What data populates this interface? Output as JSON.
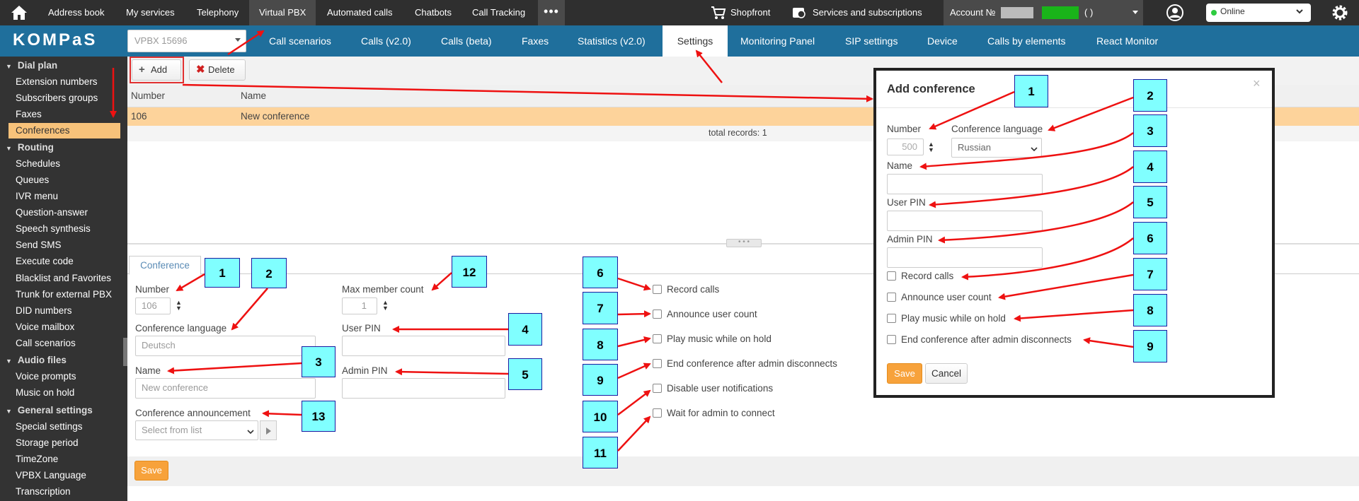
{
  "topbar": {
    "items": [
      "Address book",
      "My services",
      "Telephony",
      "Virtual PBX",
      "Automated calls",
      "Chatbots",
      "Call Tracking"
    ],
    "shopfront": "Shopfront",
    "services": "Services and subscriptions",
    "account": "Account №",
    "account_suffix": "( )",
    "status": "Online"
  },
  "logo": "KOMPaS",
  "vpbx_select": "VPBX 15696",
  "tabs": [
    "Call scenarios",
    "Calls (v2.0)",
    "Calls (beta)",
    "Faxes",
    "Statistics (v2.0)",
    "Settings",
    "Monitoring Panel",
    "SIP settings",
    "Device",
    "Calls by elements",
    "React Monitor"
  ],
  "sidebar": {
    "dial_plan": "Dial plan",
    "dial_items": [
      "Extension numbers",
      "Subscribers groups",
      "Faxes",
      "Conferences"
    ],
    "routing": "Routing",
    "routing_items": [
      "Schedules",
      "Queues",
      "IVR menu",
      "Question-answer",
      "Speech synthesis",
      "Send SMS",
      "Execute code",
      "Blacklist and Favorites",
      "Trunk for external PBX",
      "DID numbers",
      "Voice mailbox",
      "Call scenarios"
    ],
    "audio": "Audio files",
    "audio_items": [
      "Voice prompts",
      "Music on hold"
    ],
    "general": "General settings",
    "general_items": [
      "Special settings",
      "Storage period",
      "TimeZone",
      "VPBX Language",
      "Transcription"
    ]
  },
  "toolbar": {
    "add": "Add",
    "delete": "Delete"
  },
  "table": {
    "headers": [
      "Number",
      "Name"
    ],
    "rows": [
      [
        "106",
        "New conference"
      ]
    ],
    "total": "total records: 1"
  },
  "form": {
    "tab": "Conference",
    "number_label": "Number",
    "number_value": "106",
    "lang_label": "Conference language",
    "lang_value": "Deutsch",
    "name_label": "Name",
    "name_placeholder": "New conference",
    "announce_label": "Conference announcement",
    "announce_placeholder": "Select from list",
    "max_label": "Max member count",
    "max_value": "1",
    "user_pin_label": "User PIN",
    "admin_pin_label": "Admin PIN",
    "checkboxes": [
      "Record calls",
      "Announce user count",
      "Play music while on hold",
      "End conference after admin disconnects",
      "Disable user notifications",
      "Wait for admin to connect"
    ],
    "save": "Save"
  },
  "dialog": {
    "title": "Add conference",
    "close": "×",
    "number_label": "Number",
    "number_placeholder": "500",
    "lang_label": "Conference language",
    "lang_value": "Russian",
    "name_label": "Name",
    "user_pin_label": "User PIN",
    "admin_pin_label": "Admin PIN",
    "checkboxes": [
      "Record calls",
      "Announce user count",
      "Play music while on hold",
      "End conference after admin disconnects"
    ],
    "save": "Save",
    "cancel": "Cancel"
  },
  "annotations": {
    "form_numbers": [
      "1",
      "2",
      "3",
      "4",
      "5",
      "6",
      "7",
      "8",
      "9",
      "10",
      "11",
      "12",
      "13"
    ],
    "dialog_numbers": [
      "1",
      "2",
      "3",
      "4",
      "5",
      "6",
      "7",
      "8",
      "9"
    ],
    "arrow_color": "#ee1111",
    "box_color": "#80ffff"
  },
  "colors": {
    "accent": "#1f6f9c",
    "highlight": "#fdd39b",
    "save": "#f7a23b"
  }
}
